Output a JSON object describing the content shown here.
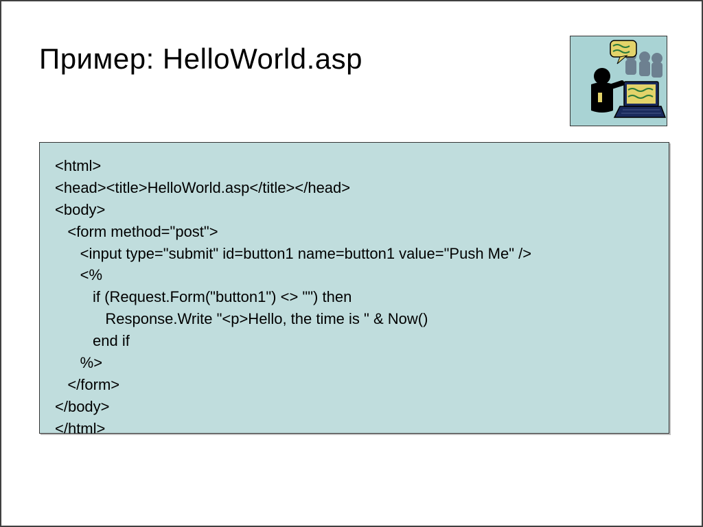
{
  "title": "Пример: HelloWorld.asp",
  "code": "<html>\n<head><title>HelloWorld.asp</title></head>\n<body>\n   <form method=\"post\">\n      <input type=\"submit\" id=button1 name=button1 value=\"Push Me\" />\n      <%\n         if (Request.Form(\"button1\") <> \"\") then\n            Response.Write \"<p>Hello, the time is \" & Now()\n         end if\n      %>\n   </form>\n</body>\n</html>"
}
